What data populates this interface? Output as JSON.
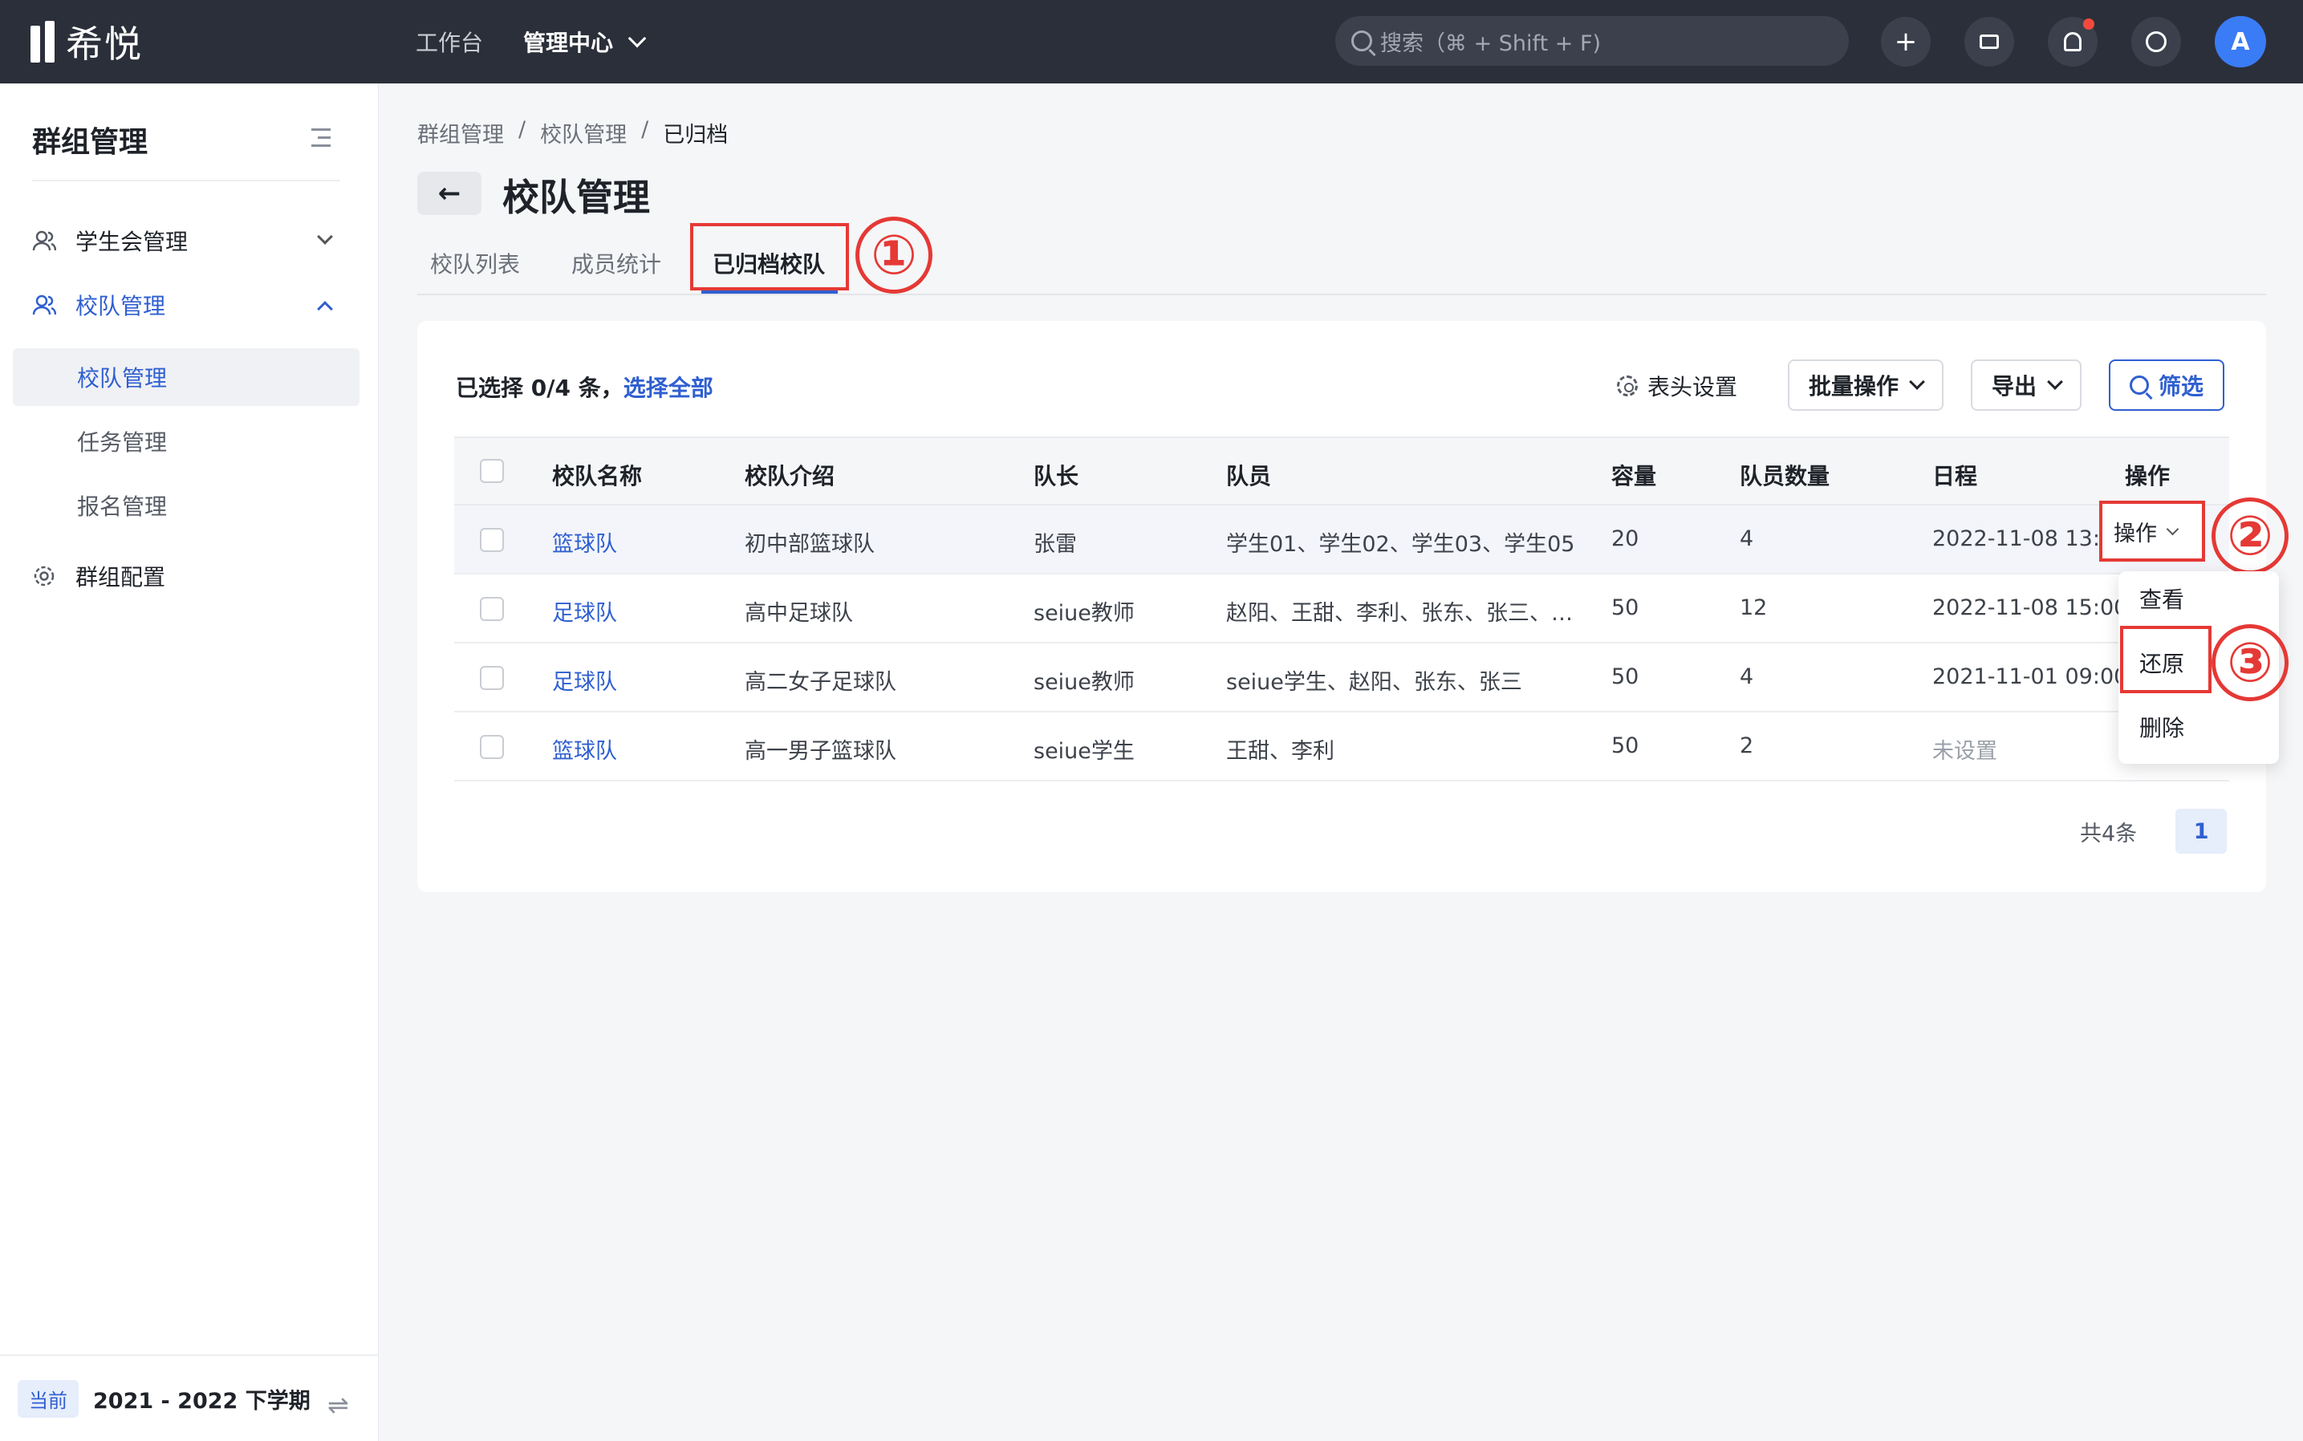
{
  "app": {
    "logo_text": "希悦"
  },
  "topnav": {
    "items": [
      "工作台",
      "管理中心"
    ]
  },
  "search": {
    "placeholder": "搜索（⌘ + Shift + F)"
  },
  "topbar_icons": [
    "plus-icon",
    "message-icon",
    "bell-icon",
    "support-icon"
  ],
  "user": {
    "avatar_letter": "A"
  },
  "sidebar": {
    "title": "群组管理",
    "items": [
      {
        "label": "学生会管理",
        "icon": "users-icon",
        "expanded": false
      },
      {
        "label": "校队管理",
        "icon": "users-icon",
        "expanded": true,
        "children": [
          "校队管理",
          "任务管理",
          "报名管理"
        ]
      },
      {
        "label": "群组配置",
        "icon": "gear-icon"
      }
    ],
    "term_badge": "当前",
    "term": "2021 - 2022 下学期"
  },
  "breadcrumb": [
    "群组管理",
    "校队管理",
    "已归档"
  ],
  "page_title": "校队管理",
  "tabs": [
    "校队列表",
    "成员统计",
    "已归档校队"
  ],
  "toolbar": {
    "selection_text": "已选择 0/4 条，",
    "select_all": "选择全部",
    "header_settings": "表头设置",
    "batch": "批量操作",
    "export": "导出",
    "filter": "筛选"
  },
  "table": {
    "columns": [
      "校队名称",
      "校队介绍",
      "队长",
      "队员",
      "容量",
      "队员数量",
      "日程",
      "操作"
    ],
    "rows": [
      {
        "name": "篮球队",
        "intro": "初中部篮球队",
        "captain": "张雷",
        "members": "学生01、学生02、学生03、学生05",
        "capacity": "20",
        "count": "4",
        "schedule": "2022-11-08 13:00"
      },
      {
        "name": "足球队",
        "intro": "高中足球队",
        "captain": "seiue教师",
        "members": "赵阳、王甜、李利、张东、张三、…",
        "capacity": "50",
        "count": "12",
        "schedule": "2022-11-08 15:00"
      },
      {
        "name": "足球队",
        "intro": "高二女子足球队",
        "captain": "seiue教师",
        "members": "seiue学生、赵阳、张东、张三",
        "capacity": "50",
        "count": "4",
        "schedule": "2021-11-01 09:00"
      },
      {
        "name": "篮球队",
        "intro": "高一男子篮球队",
        "captain": "seiue学生",
        "members": "王甜、李利",
        "capacity": "50",
        "count": "2",
        "schedule": "未设置"
      }
    ],
    "row_action": "操作"
  },
  "action_menu": [
    "查看",
    "还原",
    "删除"
  ],
  "pagination": {
    "total": "共4条",
    "current": "1"
  },
  "annotations": [
    "①",
    "②",
    "③"
  ],
  "colors": {
    "accent": "#2f5fd0",
    "annotation": "#e53935",
    "topbar": "#2b2f3a"
  }
}
